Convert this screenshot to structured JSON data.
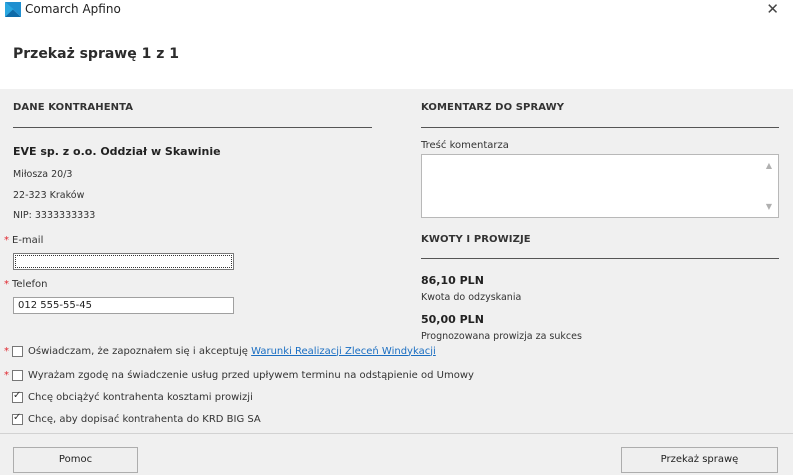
{
  "window": {
    "title": "Comarch Apfino",
    "close_glyph": "✕"
  },
  "page": {
    "title": "Przekaż sprawę 1 z 1"
  },
  "contractor": {
    "section_title": "DANE KONTRAHENTA",
    "name": "EVE sp. z o.o. Oddział w Skawinie",
    "street": "Miłosza 20/3",
    "city": "22-323 Kraków",
    "nip": "NIP:  3333333333",
    "email_label": "E-mail",
    "email_value": "",
    "phone_label": "Telefon",
    "phone_value": "012 555-55-45"
  },
  "comment": {
    "section_title": "KOMENTARZ DO SPRAWY",
    "field_label": "Treść komentarza",
    "value": ""
  },
  "amounts": {
    "section_title": "KWOTY I PROWIZJE",
    "recover_amount": "86,10 PLN",
    "recover_label": "Kwota do odzyskania",
    "commission_amount": "50,00 PLN",
    "commission_label": "Prognozowana prowizja za sukces"
  },
  "consents": [
    {
      "required": true,
      "checked": false,
      "text": "Oświadczam, że zapoznałem się i akceptuję ",
      "link": "Warunki Realizacji Zleceń Windykacji"
    },
    {
      "required": true,
      "checked": false,
      "text": "Wyrażam zgodę na świadczenie usług przed upływem terminu na odstąpienie od Umowy"
    },
    {
      "required": false,
      "checked": true,
      "text": "Chcę obciążyć kontrahenta kosztami prowizji"
    },
    {
      "required": false,
      "checked": true,
      "text": "Chcę, aby dopisać kontrahenta do KRD BIG SA"
    }
  ],
  "required_mark": "*",
  "footer": {
    "help_label": "Pomoc",
    "submit_label": "Przekaż sprawę"
  },
  "colors": {
    "brand_blue": "#1f8fd0",
    "required_red": "#e0262e",
    "link_blue": "#1a6ec2"
  }
}
